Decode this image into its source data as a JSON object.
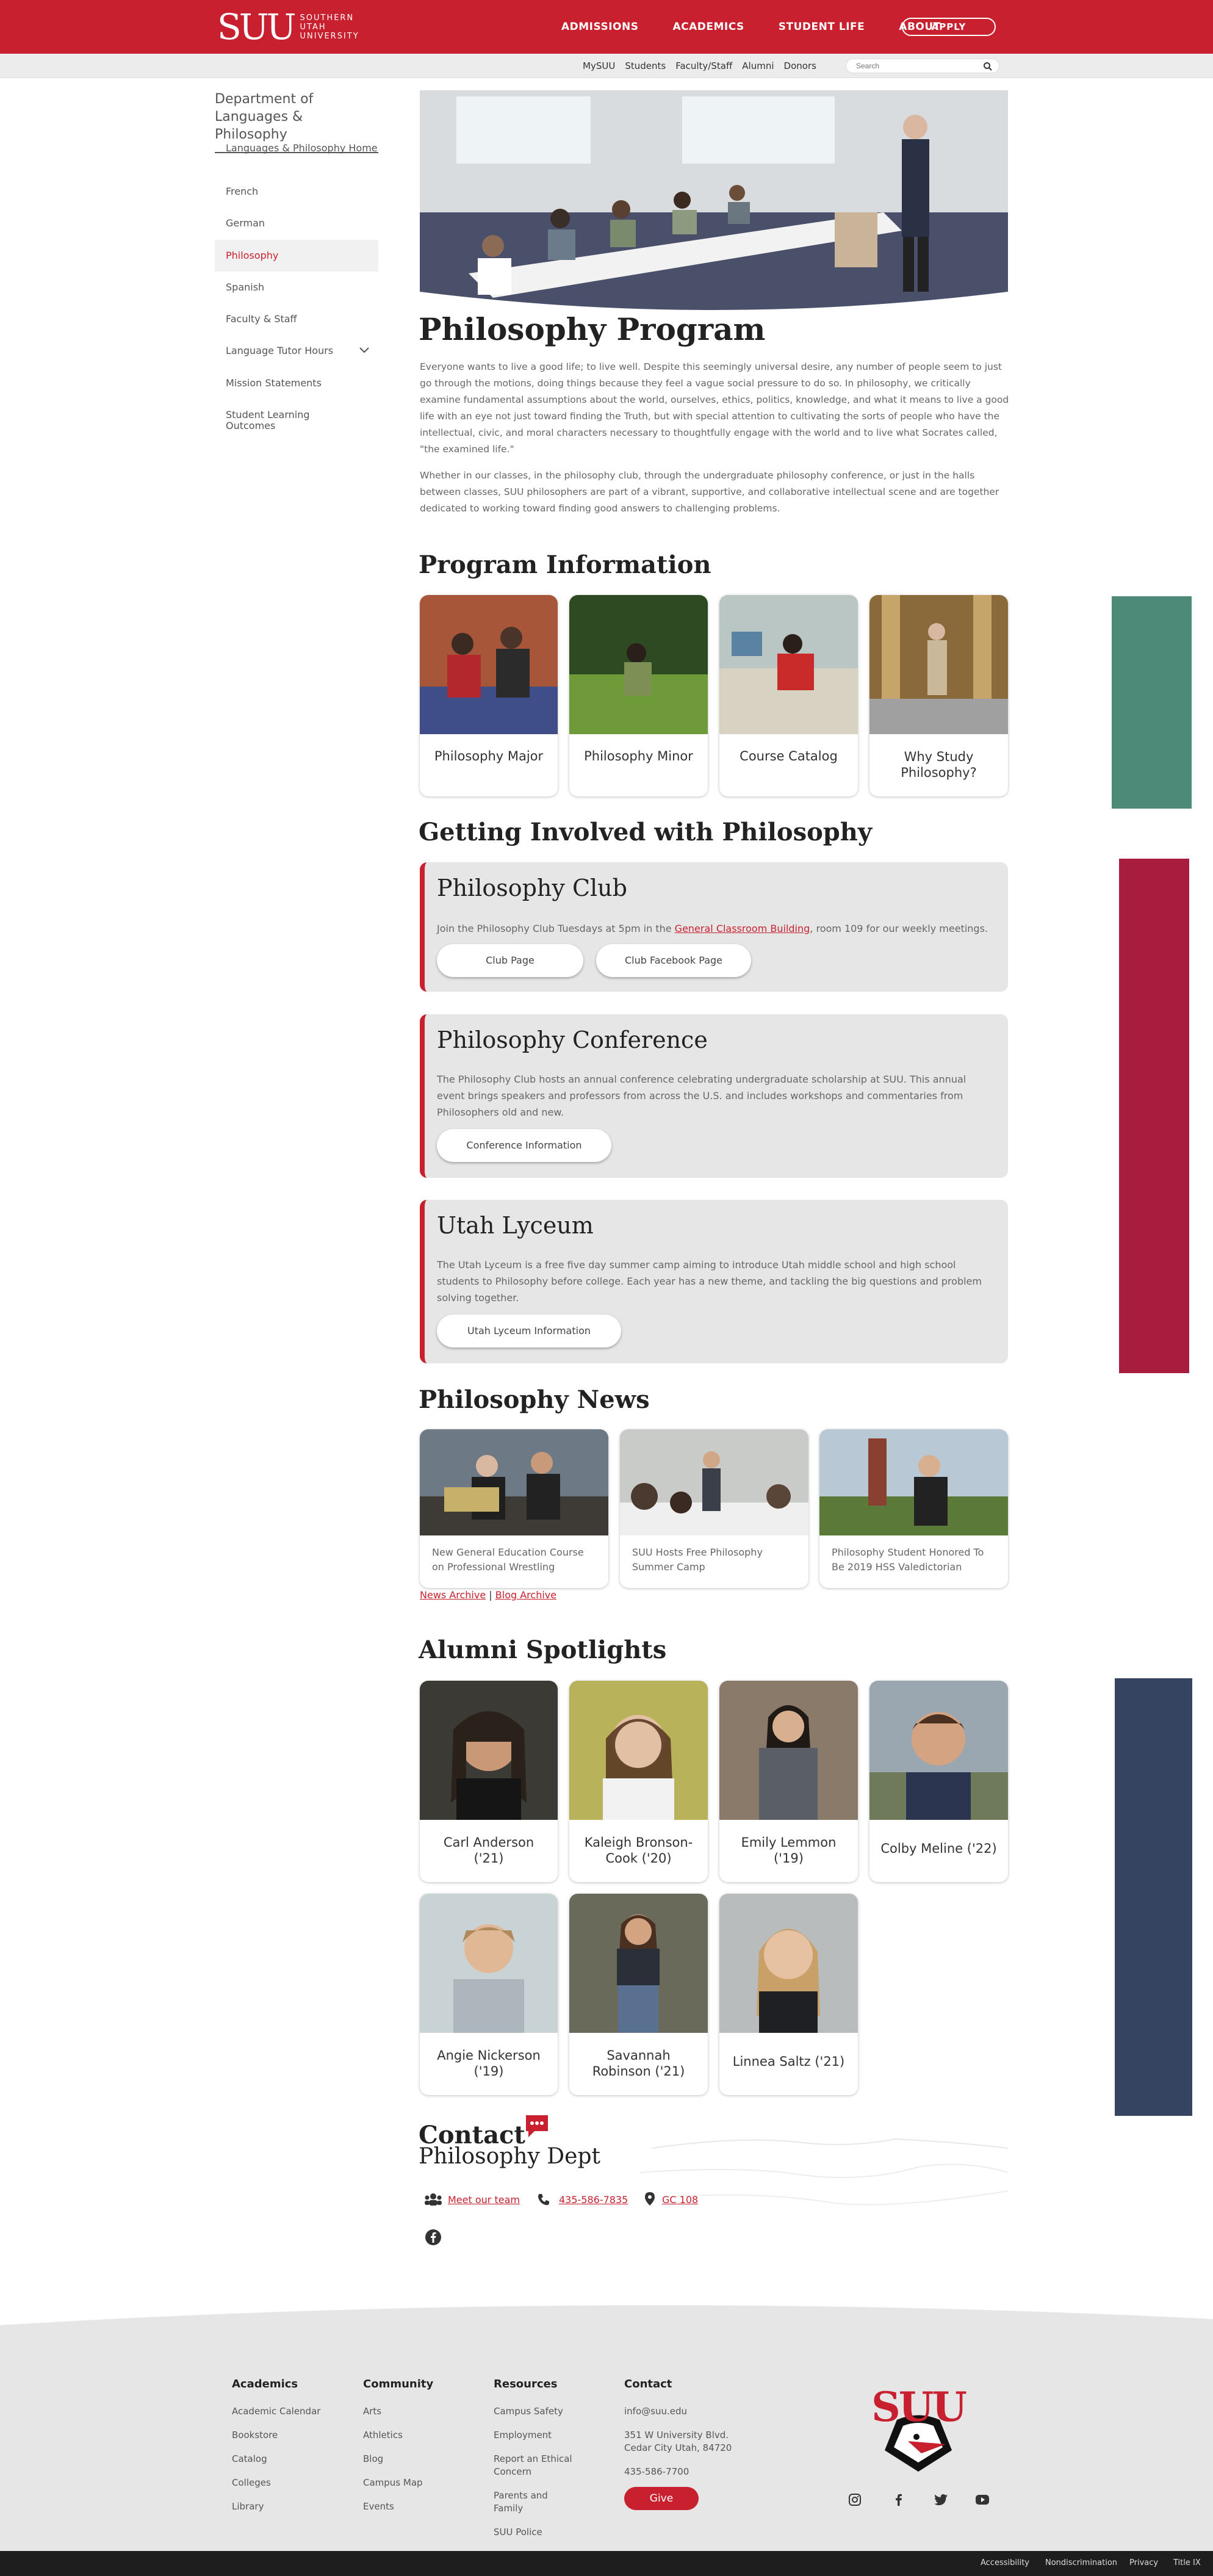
{
  "header": {
    "logo_big": "SUU",
    "logo_small": "SOUTHERN UTAH UNIVERSITY",
    "nav": [
      "ADMISSIONS",
      "ACADEMICS",
      "STUDENT LIFE",
      "ABOUT"
    ],
    "apply": "APPLY",
    "subnav": [
      "MySUU",
      "Students",
      "Faculty/Staff",
      "Alumni",
      "Donors"
    ],
    "search_placeholder": "Search"
  },
  "sidebar": {
    "title": "Department of Languages & Philosophy",
    "items": [
      {
        "label": "Languages & Philosophy Home"
      },
      {
        "label": "French"
      },
      {
        "label": "German"
      },
      {
        "label": "Philosophy"
      },
      {
        "label": "Spanish"
      },
      {
        "label": "Faculty & Staff"
      },
      {
        "label": "Language Tutor Hours"
      },
      {
        "label": "Mission Statements"
      },
      {
        "label": "Student Learning Outcomes"
      }
    ]
  },
  "main": {
    "title": "Philosophy Program",
    "intro1": "Everyone wants to live a good life; to live well. Despite this seemingly universal desire, any number of people seem to just go through the motions, doing things because they feel a vague social pressure to do so. In philosophy, we critically examine fundamental assumptions about the world, ourselves, ethics, politics, knowledge, and what it means to live a good life with an eye not just toward finding the Truth, but with special attention to cultivating the sorts of people who have the intellectual, civic, and moral characters necessary to thoughtfully engage with the world and to live what Socrates called, \"the examined life.\"",
    "intro2": "Whether in our classes, in the philosophy club, through the undergraduate philosophy conference, or just in the halls between classes, SUU philosophers are part of a vibrant, supportive, and collaborative intellectual scene and are together dedicated to working toward finding good answers to challenging problems.",
    "program_heading": "Program Information",
    "program_cards": [
      "Philosophy Major",
      "Philosophy Minor",
      "Course Catalog",
      "Why Study Philosophy?"
    ],
    "involved_heading": "Getting Involved with Philosophy",
    "club": {
      "title": "Philosophy Club",
      "text_before": "Join the Philosophy Club Tuesdays at 5pm in the ",
      "link": "General Classroom Building",
      "text_after": ", room 109 for our weekly meetings.",
      "btn1": "Club Page",
      "btn2": "Club Facebook Page"
    },
    "conference": {
      "title": "Philosophy Conference",
      "text": "The Philosophy Club hosts an annual conference celebrating undergraduate scholarship at SUU. This annual event brings speakers and professors from across the U.S. and includes workshops and commentaries from Philosophers old and new.",
      "btn": "Conference Information"
    },
    "lyceum": {
      "title": "Utah Lyceum",
      "text": "The Utah Lyceum is a free five day summer camp aiming to introduce Utah middle school and high school students to Philosophy before college. Each year has a new theme, and tackling the big questions and problem solving together.",
      "btn": "Utah Lyceum Information"
    },
    "news_heading": "Philosophy News",
    "news": [
      "New General Education Course on Professional Wrestling",
      "SUU Hosts Free Philosophy Summer Camp",
      "Philosophy Student Honored To Be 2019 HSS Valedictorian"
    ],
    "news_archive": "News Archive",
    "news_sep": "|",
    "blog_archive": "Blog Archive",
    "alumni_heading": "Alumni Spotlights",
    "alumni": [
      "Carl Anderson ('21)",
      "Kaleigh Bronson-Cook ('20)",
      "Emily Lemmon ('19)",
      "Colby Meline ('22)",
      "Angie Nickerson ('19)",
      "Savannah Robinson ('21)",
      "Linnea Saltz ('21)"
    ],
    "contact": {
      "heading": "Contact",
      "sub": "Philosophy Dept",
      "team": "Meet our team",
      "phone": "435-586-7835",
      "room": "GC 108"
    }
  },
  "footer": {
    "academics": {
      "title": "Academics",
      "links": [
        "Academic Calendar",
        "Bookstore",
        "Catalog",
        "Colleges",
        "Library"
      ]
    },
    "community": {
      "title": "Community",
      "links": [
        "Arts",
        "Athletics",
        "Blog",
        "Campus Map",
        "Events"
      ]
    },
    "resources": {
      "title": "Resources",
      "links": [
        "Campus Safety",
        "Employment",
        "Report an Ethical Concern",
        "Parents and Family",
        "SUU Police"
      ]
    },
    "contact": {
      "title": "Contact",
      "email": "info@suu.edu",
      "address": "351 W University Blvd. Cedar City Utah, 84720",
      "phone": "435-586-7700",
      "give": "Give"
    },
    "logo_text": "SUU",
    "bottom_links": [
      "Accessibility",
      "Nondiscrimination",
      "Privacy",
      "Title IX"
    ]
  },
  "colors": {
    "brand_red": "#c8202f",
    "side_green": "#4e8a78",
    "side_crimson": "#a81c3e",
    "side_navy": "#344461"
  }
}
